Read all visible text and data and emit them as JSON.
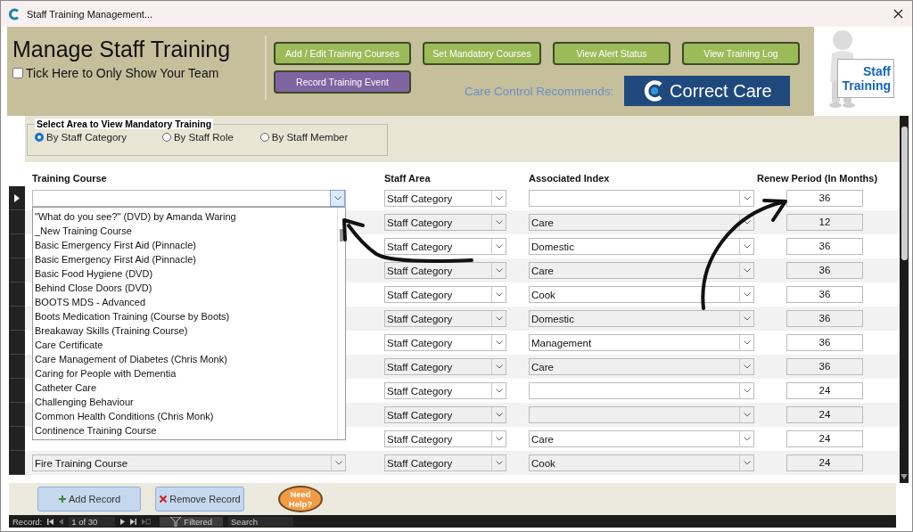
{
  "window": {
    "title": "Staff Training Management..."
  },
  "header": {
    "title": "Manage Staff Training",
    "team_filter": {
      "label": "Tick Here to Only Show Your Team",
      "checked": false
    },
    "buttons": [
      {
        "label": "Add / Edit Training Courses",
        "kind": "green"
      },
      {
        "label": "Set Mandatory Courses",
        "kind": "green"
      },
      {
        "label": "View Alert Status",
        "kind": "green"
      },
      {
        "label": "View Training Log",
        "kind": "green"
      },
      {
        "label": "Record Training Event",
        "kind": "purple"
      }
    ],
    "recommends": "Care Control Recommends:",
    "logo_text": "Correct Care",
    "sign_lines": [
      "Staff",
      "Training"
    ]
  },
  "area_filter": {
    "title": "Select Area to View Mandatory Training",
    "options": [
      {
        "label": "By Staff Category",
        "selected": true
      },
      {
        "label": "By Staff Role",
        "selected": false
      },
      {
        "label": "By Staff Member",
        "selected": false
      }
    ]
  },
  "columns": [
    "Training Course",
    "Staff Area",
    "Associated Index",
    "Renew Period (In Months)"
  ],
  "rows": [
    {
      "current": true,
      "staff_area": "Staff Category",
      "renew": "36"
    },
    {
      "current": false,
      "staff_area": "Staff Category",
      "index": "Care",
      "renew": "12"
    },
    {
      "current": false,
      "staff_area": "Staff Category",
      "index": "Domestic",
      "renew": "36"
    },
    {
      "current": false,
      "staff_area": "Staff Category",
      "index": "Care",
      "renew": "36"
    },
    {
      "current": false,
      "staff_area": "Staff Category",
      "index": "Cook",
      "renew": "36"
    },
    {
      "current": false,
      "staff_area": "Staff Category",
      "index": "Domestic",
      "renew": "36"
    },
    {
      "current": false,
      "staff_area": "Staff Category",
      "index": "Management",
      "renew": "36"
    },
    {
      "current": false,
      "staff_area": "Staff Category",
      "index": "Care",
      "renew": "36"
    },
    {
      "current": false,
      "staff_area": "Staff Category",
      "renew": "24"
    },
    {
      "current": false,
      "staff_area": "Staff Category",
      "renew": "24"
    },
    {
      "current": false,
      "staff_area": "Staff Category",
      "index": "Care",
      "renew": "24"
    },
    {
      "current": false,
      "course": "Fire Training Course",
      "staff_area": "Staff Category",
      "index": "Cook",
      "renew": "24"
    }
  ],
  "course_dropdown": {
    "items": [
      "\"What do you see?\" (DVD) by Amanda Waring",
      "_New Training Course",
      "Basic Emergency First Aid (Pinnacle)",
      "Basic Emergency First Aid (Pinnacle)",
      "Basic Food Hygiene (DVD)",
      "Behind Close Doors (DVD)",
      "BOOTS MDS - Advanced",
      "Boots Medication Training (Course by Boots)",
      "Breakaway Skills (Training Course)",
      "Care Certificate",
      "Care Management of Diabetes (Chris Monk)",
      "Caring for People with Dementia",
      "Catheter Care",
      "Challenging Behaviour",
      "Common Health Conditions (Chris Monk)",
      "Continence Training Course"
    ]
  },
  "footer": {
    "buttons": [
      {
        "label": "Add Record",
        "kind": "add"
      },
      {
        "label": "Remove Record",
        "kind": "remove"
      }
    ],
    "help": "Need Help?"
  },
  "navigation": {
    "label": "Record:",
    "position": "1 of 30",
    "filter": "Filtered",
    "search": "Search"
  }
}
